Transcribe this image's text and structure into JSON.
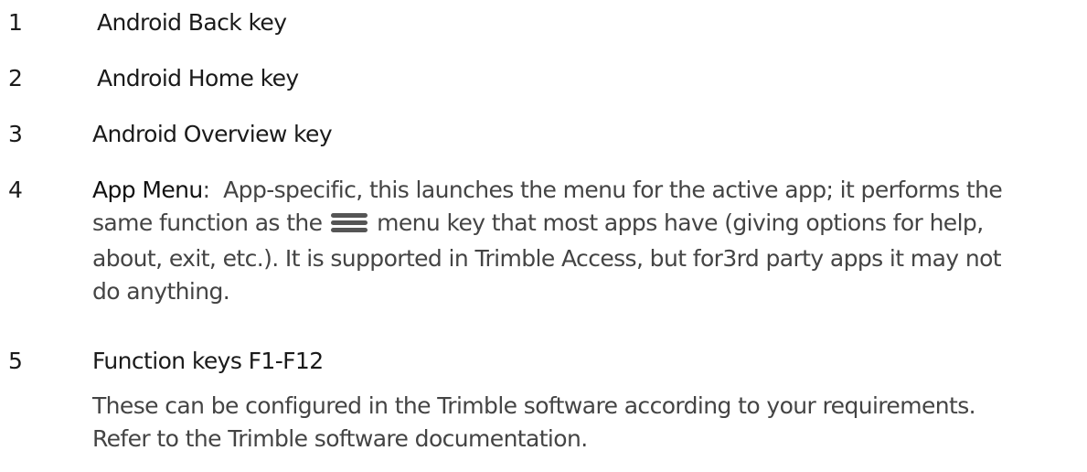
{
  "items": [
    {
      "number": "1",
      "title": "Android Back key"
    },
    {
      "number": "2",
      "title": "Android Home key"
    },
    {
      "number": "3",
      "title": "Android Overview key"
    },
    {
      "number": "4",
      "title": "App Menu",
      "separator": ":  ",
      "line1": "App-specific, this launches the menu for the active app; it performs the",
      "line2_before_icon": "same function as the ",
      "menu_icon": "hamburger-menu-icon",
      "line2_after_icon": " menu key that most apps have (giving options for help,",
      "line3": "about, exit, etc.). It is supported in Trimble Access, but for3rd party apps it may not",
      "line4": "do anything."
    },
    {
      "number": "5",
      "title": "Function keys F1-F12",
      "line1": "These can be configured in the Trimble software according to your requirements.",
      "line2": "Refer to the Trimble software documentation."
    }
  ],
  "colors": {
    "text_dark": "#111111",
    "text_body": "#444444",
    "icon": "#555555"
  }
}
